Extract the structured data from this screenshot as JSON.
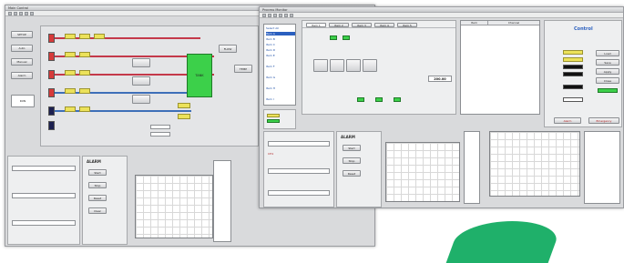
{
  "back_window": {
    "title": "Main Control",
    "left_buttons": [
      "SETUP",
      "Auto",
      "Manual",
      "Alarm"
    ],
    "status_box": "RUN",
    "center_label": "TANK",
    "right_labels": [
      "FLOW",
      "TEMP"
    ],
    "bottom_panel_title": "ALARM",
    "bottom_buttons": [
      "Start",
      "Stop",
      "Reset",
      "Clear"
    ]
  },
  "front_window": {
    "title": "Process Monitor",
    "tabs": [
      "Item 1",
      "Item 2",
      "Item 3",
      "Item 4",
      "Item 5"
    ],
    "dropdown_items": [
      "Select All",
      "Item A",
      "Item B",
      "Item C",
      "Item D",
      "Item E",
      "Item F",
      "Item G",
      "Item H",
      "Item I"
    ],
    "readout_value": "200.00",
    "table_headers": [
      "Item",
      "Channel"
    ],
    "right_panel_title": "Control",
    "right_buttons": [
      "Load",
      "Save",
      "Apply",
      "Close"
    ],
    "alarm_title": "ALARM",
    "alarm_buttons": [
      "Start",
      "Stop",
      "Reset"
    ],
    "bottom_left_label": "CH1",
    "bottom_right_btns": [
      "Alarm",
      "Emergency"
    ]
  },
  "colors": {
    "accent_green": "#1fb06a",
    "pipe_red": "#c4394a",
    "pipe_blue": "#3d6fb8"
  }
}
